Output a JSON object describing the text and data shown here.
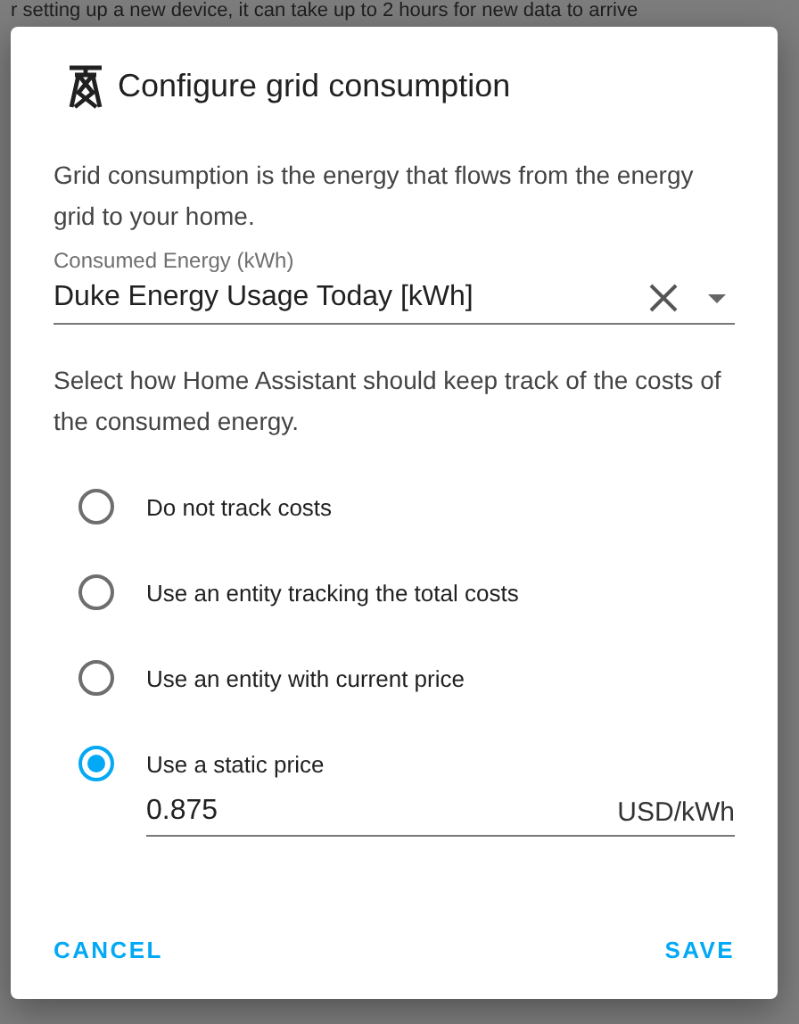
{
  "backdrop": {
    "notice": "r setting up a new device, it can take up to 2 hours for new data to arrive"
  },
  "dialog": {
    "title": "Configure grid consumption",
    "description": "Grid consumption is the energy that flows from the energy grid to your home.",
    "entity_field": {
      "label": "Consumed Energy (kWh)",
      "value": "Duke Energy Usage Today [kWh]"
    },
    "cost_prompt": "Select how Home Assistant should keep track of the costs of the consumed energy.",
    "cost_options": [
      {
        "label": "Do not track costs",
        "selected": false
      },
      {
        "label": "Use an entity tracking the total costs",
        "selected": false
      },
      {
        "label": "Use an entity with current price",
        "selected": false
      },
      {
        "label": "Use a static price",
        "selected": true,
        "price": {
          "value": "0.875",
          "suffix": "USD/kWh"
        }
      }
    ],
    "buttons": [
      {
        "label": "CANCEL"
      },
      {
        "label": "SAVE"
      }
    ]
  }
}
